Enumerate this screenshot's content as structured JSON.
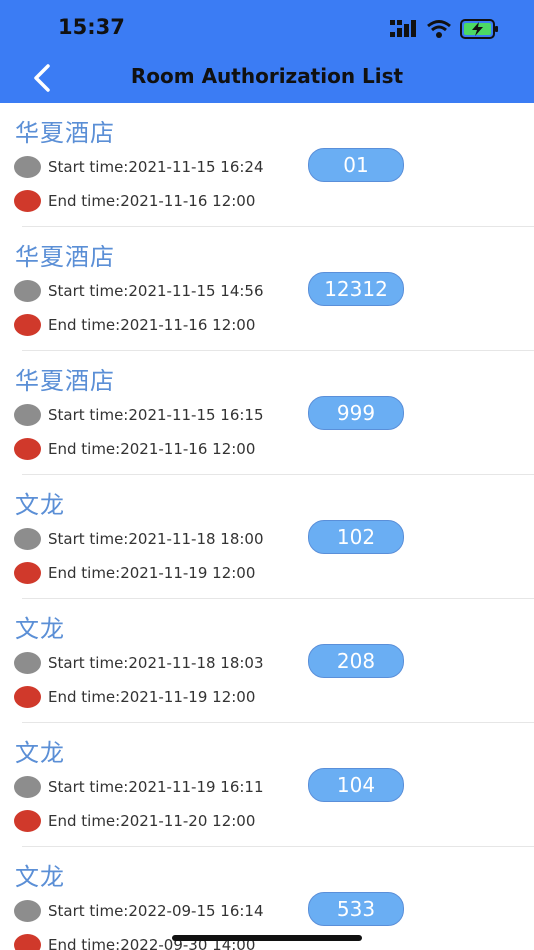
{
  "status_bar": {
    "time": "15:37"
  },
  "header": {
    "title": "Room Authorization List"
  },
  "items": [
    {
      "name": "华夏酒店",
      "start": "Start time:2021-11-15 16:24",
      "end": "End time:2021-11-16 12:00",
      "room": "01"
    },
    {
      "name": "华夏酒店",
      "start": "Start time:2021-11-15 14:56",
      "end": "End time:2021-11-16 12:00",
      "room": "12312"
    },
    {
      "name": "华夏酒店",
      "start": "Start time:2021-11-15 16:15",
      "end": "End time:2021-11-16 12:00",
      "room": "999"
    },
    {
      "name": "文龙",
      "start": "Start time:2021-11-18 18:00",
      "end": "End time:2021-11-19 12:00",
      "room": "102"
    },
    {
      "name": "文龙",
      "start": "Start time:2021-11-18 18:03",
      "end": "End time:2021-11-19 12:00",
      "room": "208"
    },
    {
      "name": "文龙",
      "start": "Start time:2021-11-19 16:11",
      "end": "End time:2021-11-20 12:00",
      "room": "104"
    },
    {
      "name": "文龙",
      "start": "Start time:2022-09-15 16:14",
      "end": "End time:2022-09-30 14:00",
      "room": "533"
    }
  ],
  "colors": {
    "header_bg": "#3b7cf4",
    "hotel_name": "#5b8fd6",
    "badge_bg": "#6aaef3",
    "start_dot": "#8d8d8d",
    "end_dot": "#d0392b"
  }
}
